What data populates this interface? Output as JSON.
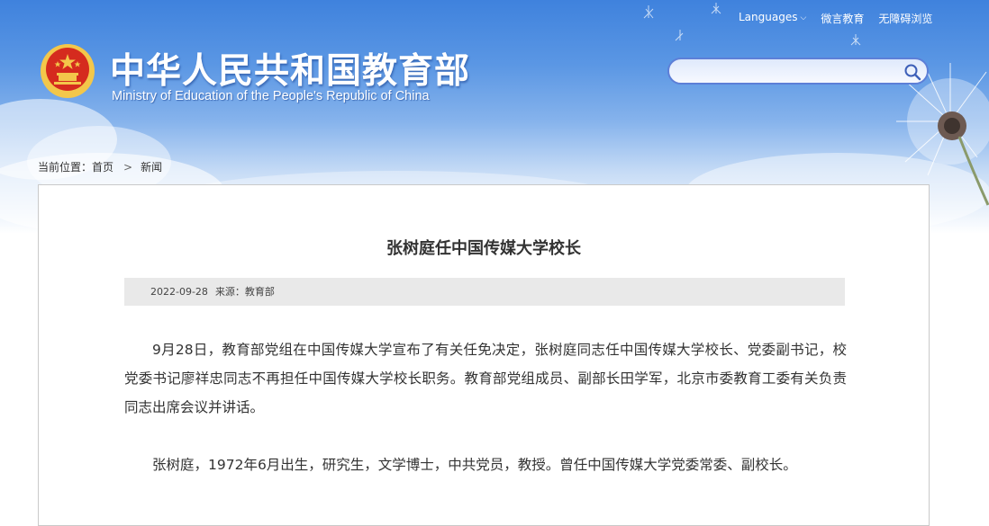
{
  "header": {
    "title_cn": "中华人民共和国教育部",
    "title_en": "Ministry of Education of the People's Republic of China",
    "top_links": {
      "languages": "Languages",
      "wechat": "微言教育",
      "accessibility": "无障碍浏览"
    },
    "search": {
      "value": "",
      "placeholder": ""
    }
  },
  "breadcrumb": {
    "prefix": "当前位置：",
    "home": "首页",
    "separator": ">",
    "current": "新闻"
  },
  "article": {
    "title": "张树庭任中国传媒大学校长",
    "date": "2022-09-28",
    "source": "来源：教育部",
    "paragraphs": [
      "9月28日，教育部党组在中国传媒大学宣布了有关任免决定，张树庭同志任中国传媒大学校长、党委副书记，校党委书记廖祥忠同志不再担任中国传媒大学校长职务。教育部党组成员、副部长田学军，北京市委教育工委有关负责同志出席会议并讲话。",
      "张树庭，1972年6月出生，研究生，文学博士，中共党员，教授。曾任中国传媒大学党委常委、副校长。"
    ]
  },
  "colors": {
    "header_blue": "#4a88e0",
    "emblem_red": "#d52b1e",
    "emblem_gold": "#f3c74a",
    "meta_bar_bg": "#e9e9e9",
    "text": "#333333"
  },
  "icons": [
    "national-emblem-icon",
    "search-icon",
    "chevron-down-icon",
    "dandelion-decoration"
  ]
}
